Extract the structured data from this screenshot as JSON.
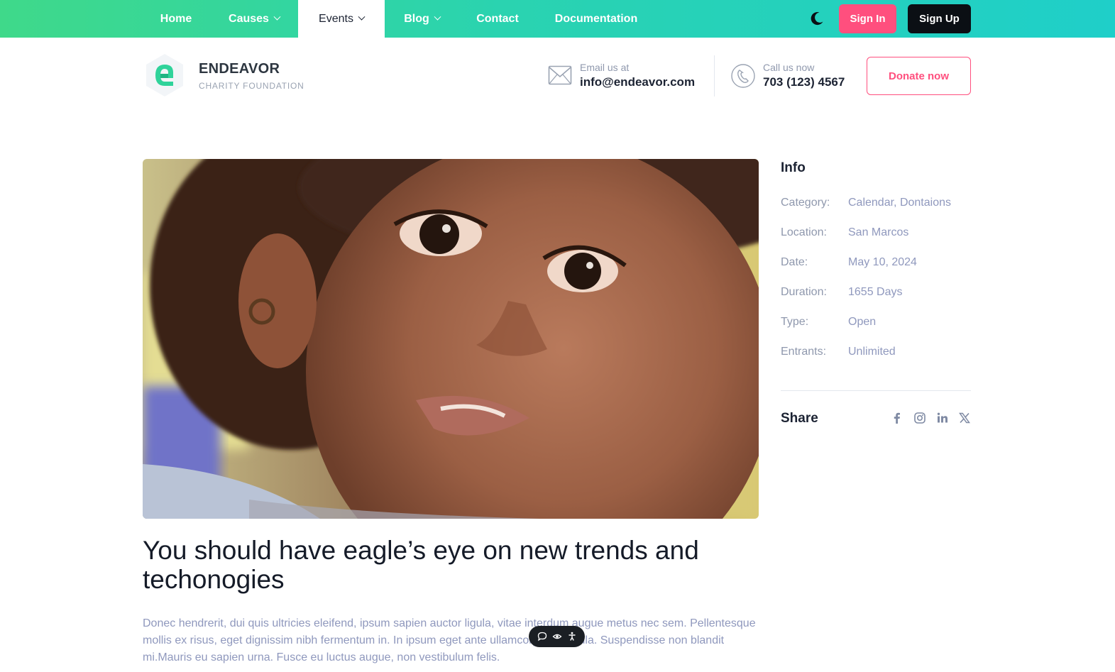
{
  "nav": {
    "items": [
      {
        "label": "Home"
      },
      {
        "label": "Causes"
      },
      {
        "label": "Events"
      },
      {
        "label": "Blog"
      },
      {
        "label": "Contact"
      },
      {
        "label": "Documentation"
      }
    ],
    "active": "Events",
    "sign_in": "Sign In",
    "sign_up": "Sign Up",
    "theme_icon": "moon-icon"
  },
  "brand": {
    "name": "ENDEAVOR",
    "subtitle": "CHARITY FOUNDATION",
    "accent": "#2fd39a"
  },
  "contact": {
    "email_label": "Email us at",
    "email_value": "info@endeavor.com",
    "phone_label": "Call us now",
    "phone_value": "703 (123) 4567",
    "donate_label": "Donate now"
  },
  "post": {
    "title": "You should have eagle’s eye on new trends and techonogies",
    "body": "Donec hendrerit, dui quis ultricies eleifend, ipsum sapien auctor ligula, vitae interdum augue metus nec sem. Pellentesque mollis ex risus, eget dignissim nibh fermentum in. In ipsum eget ante ullamcorper vehicula. Suspendisse non blandit mi.Mauris eu sapien urna. Fusce eu luctus augue, non vestibulum felis."
  },
  "sidebar": {
    "info_heading": "Info",
    "rows": [
      {
        "key": "Category:",
        "value": "Calendar, Dontaions"
      },
      {
        "key": "Location:",
        "value": "San Marcos"
      },
      {
        "key": "Date:",
        "value": "May 10, 2024"
      },
      {
        "key": "Duration:",
        "value": "1655 Days"
      },
      {
        "key": "Type:",
        "value": "Open"
      },
      {
        "key": "Entrants:",
        "value": "Unlimited"
      }
    ],
    "share_heading": "Share",
    "share_icons": [
      "facebook-icon",
      "instagram-icon",
      "linkedin-icon",
      "x-icon"
    ]
  },
  "colors": {
    "nav_gradient_start": "#3fd98a",
    "nav_gradient_end": "#1fcfc9",
    "primary_pink": "#ff4f7e",
    "dark": "#0b0f14",
    "muted_text": "#8f98bd"
  }
}
